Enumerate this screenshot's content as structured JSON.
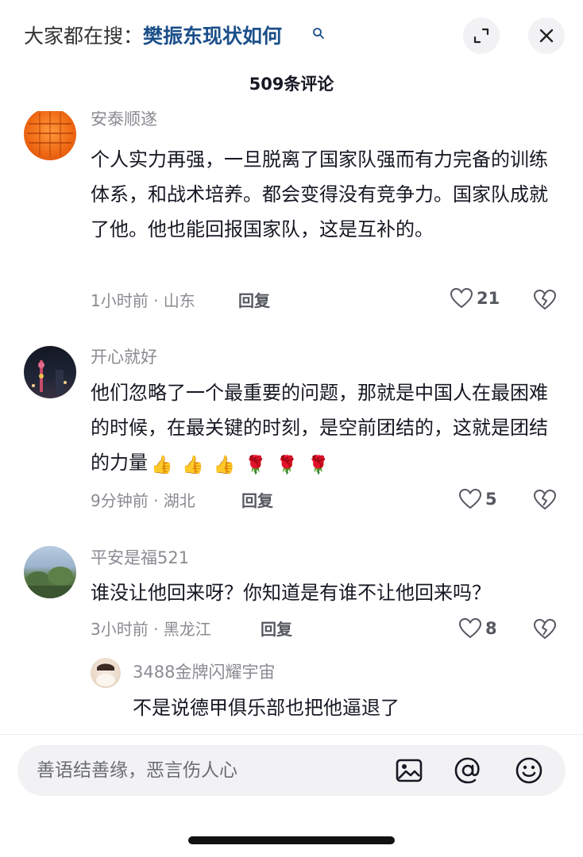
{
  "header": {
    "search_prefix": "大家都在搜：",
    "search_query": "樊振东现状如何",
    "comment_count": "509条评论"
  },
  "comments": [
    {
      "username": "安泰顺遂",
      "body": "个人实力再强，一旦脱离了国家队强而有力完备的训练体系，和战术培养。都会变得没有竞争力。国家队成就了他。他也能回报国家队，这是互补的。",
      "meta": "1小时前 · 山东",
      "reply_label": "回复",
      "likes": "21"
    },
    {
      "username": "开心就好",
      "body": "他们忽略了一个最重要的问题，那就是中国人在最困难的时候，在最关键的时刻，是空前团结的，这就是团结的力量",
      "emojis": "👍👍👍🌹🌹🌹",
      "meta": "9分钟前 · 湖北",
      "reply_label": "回复",
      "likes": "5"
    },
    {
      "username": "平安是福521",
      "body": "谁没让他回来呀？你知道是有谁不让他回来吗？",
      "meta": "3小时前 · 黑龙江",
      "reply_label": "回复",
      "likes": "8"
    }
  ],
  "reply": {
    "username": "3488金牌闪耀宇宙",
    "body": "不是说德甲俱乐部也把他逼退了"
  },
  "input": {
    "placeholder": "善语结善缘，恶言伤人心"
  },
  "colors": {
    "query": "#1b4f8a",
    "muted": "#8a8b91",
    "text": "#161823",
    "bar_bg": "#f2f2f4"
  },
  "icons": [
    "search-icon",
    "expand-icon",
    "close-icon",
    "heart-icon",
    "broken-heart-icon",
    "image-icon",
    "at-icon",
    "emoji-icon"
  ]
}
